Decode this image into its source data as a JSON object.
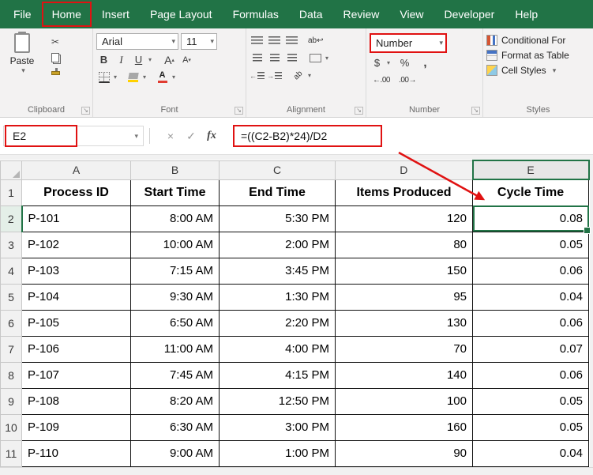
{
  "colors": {
    "excel_green": "#217346",
    "annotation_red": "#e01212",
    "ribbon_bg": "#f3f2f2"
  },
  "ribbon_tabs": [
    "File",
    "Home",
    "Insert",
    "Page Layout",
    "Formulas",
    "Data",
    "Review",
    "View",
    "Developer",
    "Help"
  ],
  "active_tab": "Home",
  "ribbon": {
    "clipboard": {
      "group_label": "Clipboard",
      "paste_label": "Paste"
    },
    "font": {
      "group_label": "Font",
      "font_name": "Arial",
      "font_size": "11"
    },
    "alignment": {
      "group_label": "Alignment"
    },
    "number": {
      "group_label": "Number",
      "format": "Number"
    },
    "styles": {
      "group_label": "Styles",
      "items": [
        "Conditional For",
        "Format as Table",
        "Cell Styles"
      ]
    }
  },
  "icons": {
    "chevron_down": "▾",
    "cut": "✂",
    "bold": "B",
    "italic": "I",
    "underline": "U",
    "grow_font": "A",
    "shrink_font": "A",
    "caret_up": "▴",
    "caret_down": "▾",
    "dollar": "$",
    "percent": "%",
    "comma": ",",
    "increase_decimal": "←.00",
    "decrease_decimal": ".00→",
    "indent_left": "←",
    "indent_right": "→",
    "wrap_text": "ab↩",
    "orientation": "ab",
    "cancel": "×",
    "enter": "✓",
    "fx": "fx",
    "launcher": "↘"
  },
  "formula_bar": {
    "name_box": "E2",
    "formula": "=((C2-B2)*24)/D2"
  },
  "grid": {
    "column_letters": [
      "A",
      "B",
      "C",
      "D",
      "E"
    ],
    "row_numbers": [
      "1",
      "2",
      "3",
      "4",
      "5",
      "6",
      "7",
      "8",
      "9",
      "10",
      "11"
    ],
    "selected_column": "E",
    "selected_row": 2,
    "selected_cell": "E2",
    "header_row": [
      "Process ID",
      "Start Time",
      "End Time",
      "Items Produced",
      "Cycle Time"
    ],
    "data_rows": [
      [
        "P-101",
        "8:00 AM",
        "5:30 PM",
        "120",
        "0.08"
      ],
      [
        "P-102",
        "10:00 AM",
        "2:00 PM",
        "80",
        "0.05"
      ],
      [
        "P-103",
        "7:15 AM",
        "3:45 PM",
        "150",
        "0.06"
      ],
      [
        "P-104",
        "9:30 AM",
        "1:30 PM",
        "95",
        "0.04"
      ],
      [
        "P-105",
        "6:50 AM",
        "2:20 PM",
        "130",
        "0.06"
      ],
      [
        "P-106",
        "11:00 AM",
        "4:00 PM",
        "70",
        "0.07"
      ],
      [
        "P-107",
        "7:45 AM",
        "4:15 PM",
        "140",
        "0.06"
      ],
      [
        "P-108",
        "8:20 AM",
        "12:50 PM",
        "100",
        "0.05"
      ],
      [
        "P-109",
        "6:30 AM",
        "3:00 PM",
        "160",
        "0.05"
      ],
      [
        "P-110",
        "9:00 AM",
        "1:00 PM",
        "90",
        "0.04"
      ]
    ]
  }
}
